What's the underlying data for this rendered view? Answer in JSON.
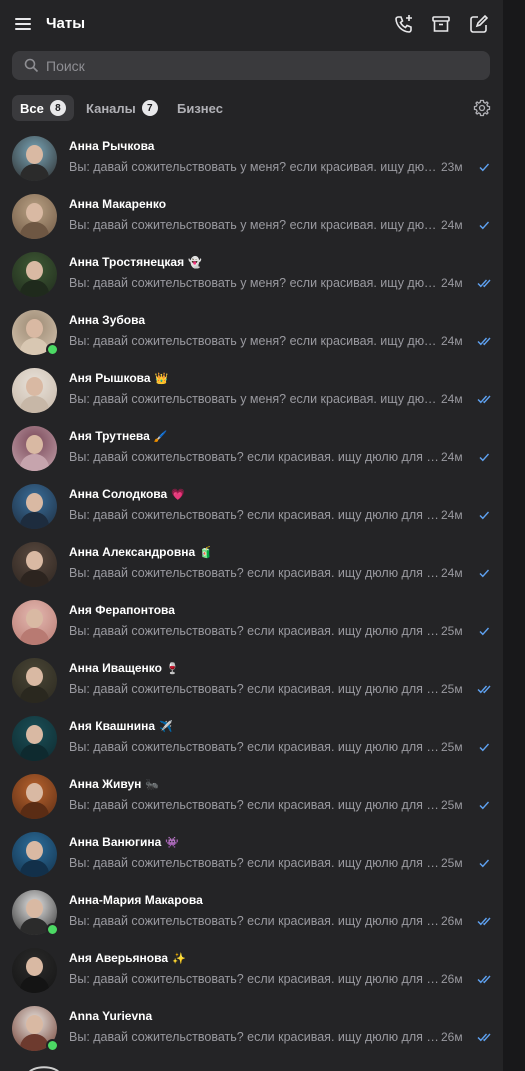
{
  "header": {
    "title": "Чаты"
  },
  "search": {
    "placeholder": "Поиск"
  },
  "tabs": [
    {
      "label": "Все",
      "count": "8"
    },
    {
      "label": "Каналы",
      "count": "7"
    },
    {
      "label": "Бизнес",
      "count": ""
    }
  ],
  "colors": {
    "background": "#242426",
    "accent": "#5ea1f0",
    "online": "#4cd964"
  },
  "chats": [
    {
      "name": "Анна Рычкова",
      "emoji": "",
      "message": "Вы: давай сожительствовать у меня? если красивая. ищу дюл...",
      "time": "23м",
      "status": "sent",
      "online": false,
      "palette": [
        "#7aa6b8",
        "#2b2b2b"
      ]
    },
    {
      "name": "Анна Макаренко",
      "emoji": "",
      "message": "Вы: давай сожительствовать у меня? если красивая. ищу дюл...",
      "time": "24м",
      "status": "sent",
      "online": false,
      "palette": [
        "#b9a184",
        "#6e5743"
      ]
    },
    {
      "name": "Анна Тростянецкая",
      "emoji": "👻",
      "message": "Вы: давай сожительствовать у меня? если красивая. ищу дюл...",
      "time": "24м",
      "status": "read",
      "online": false,
      "palette": [
        "#3f5a35",
        "#1f2a1c"
      ]
    },
    {
      "name": "Анна Зубова",
      "emoji": "",
      "message": "Вы: давай сожительствовать у меня? если красивая. ищу дюл...",
      "time": "24м",
      "status": "read",
      "online": true,
      "palette": [
        "#9c8a74",
        "#d8c7b2"
      ]
    },
    {
      "name": "Аня Рышкова",
      "emoji": "👑",
      "message": "Вы: давай сожительствовать у меня? если красивая. ищу дюл...",
      "time": "24м",
      "status": "read",
      "online": false,
      "palette": [
        "#e8e2da",
        "#c7b7a7"
      ]
    },
    {
      "name": "Аня Трутнева",
      "emoji": "🖌️",
      "message": "Вы: давай сожительствовать? если красивая. ищу дюлю для с...",
      "time": "24м",
      "status": "sent",
      "online": false,
      "palette": [
        "#7a4a5a",
        "#c6a4ad"
      ]
    },
    {
      "name": "Анна Солодкова",
      "emoji": "💗",
      "message": "Вы: давай сожительствовать? если красивая. ищу дюлю для с...",
      "time": "24м",
      "status": "sent",
      "online": false,
      "palette": [
        "#3a6e9a",
        "#1d2c3e"
      ]
    },
    {
      "name": "Анна Александровна",
      "emoji": "🧃",
      "message": "Вы: давай сожительствовать? если красивая. ищу дюлю для с...",
      "time": "24м",
      "status": "sent",
      "online": false,
      "palette": [
        "#5a4a40",
        "#2c241f"
      ]
    },
    {
      "name": "Аня Ферапонтова",
      "emoji": "",
      "message": "Вы: давай сожительствовать? если красивая. ищу дюлю для с...",
      "time": "25м",
      "status": "sent",
      "online": false,
      "palette": [
        "#e3b8b0",
        "#b87a72"
      ]
    },
    {
      "name": "Анна Иващенко",
      "emoji": "🍷",
      "message": "Вы: давай сожительствовать? если красивая. ищу дюлю для с...",
      "time": "25м",
      "status": "read",
      "online": false,
      "palette": [
        "#4a4636",
        "#2a281f"
      ]
    },
    {
      "name": "Аня Квашнина",
      "emoji": "✈️",
      "message": "Вы: давай сожительствовать? если красивая. ищу дюлю для с...",
      "time": "25м",
      "status": "sent",
      "online": false,
      "palette": [
        "#1b4f57",
        "#0e2a2f"
      ]
    },
    {
      "name": "Анна Живун",
      "emoji": "🐜",
      "message": "Вы: давай сожительствовать? если красивая. ищу дюлю для с...",
      "time": "25м",
      "status": "sent",
      "online": false,
      "palette": [
        "#b8632e",
        "#5a2c14"
      ]
    },
    {
      "name": "Анна Ванюгина",
      "emoji": "👾",
      "message": "Вы: давай сожительствовать? если красивая. ищу дюлю для с...",
      "time": "25м",
      "status": "sent",
      "online": false,
      "palette": [
        "#2d6f9c",
        "#12304a"
      ]
    },
    {
      "name": "Анна-Мария Макарова",
      "emoji": "",
      "message": "Вы: давай сожительствовать? если красивая. ищу дюлю для с...",
      "time": "26м",
      "status": "read",
      "online": true,
      "palette": [
        "#e6e6e6",
        "#2b2b2b"
      ]
    },
    {
      "name": "Аня Аверьянова",
      "emoji": "✨",
      "message": "Вы: давай сожительствовать? если красивая. ищу дюлю для с...",
      "time": "26м",
      "status": "read",
      "online": false,
      "palette": [
        "#2b2b2b",
        "#141414"
      ]
    },
    {
      "name": "Anna Yurievna",
      "emoji": "",
      "message": "Вы: давай сожительствовать? если красивая. ищу дюлю для с...",
      "time": "26м",
      "status": "read",
      "online": true,
      "palette": [
        "#e8e3de",
        "#6d3a2e"
      ]
    }
  ]
}
